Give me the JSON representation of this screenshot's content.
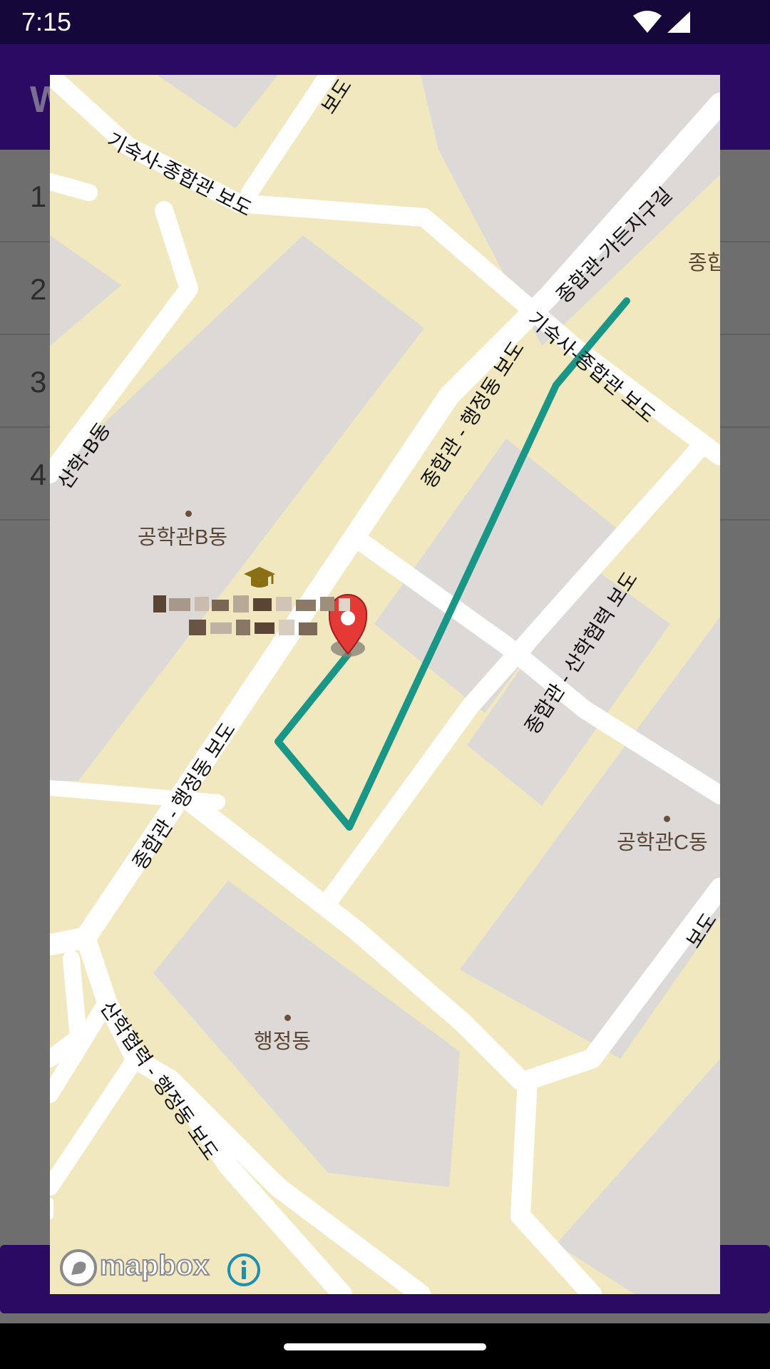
{
  "status_bar": {
    "time": "7:15"
  },
  "app": {
    "title": "W",
    "list": [
      "1",
      "2",
      "3",
      "4"
    ]
  },
  "map": {
    "attribution": "mapbox",
    "labels": {
      "engineering_b": "공학관B동",
      "engineering_c": "공학관C동",
      "admin": "행정동",
      "jonghap": "종합"
    },
    "road_labels": {
      "dorm_walk_top": "기숙사-종합관 보도",
      "dorm_walk_mid": "기숙사-종합관 보도",
      "jonghap_garden": "종합관-가든지구길",
      "jonghap_admin_upper": "종합관 - 행정동 보도",
      "jonghap_admin_lower": "종합관 - 행정동 보도",
      "jonghap_sanhak": "종합관 - 산학협력 보도",
      "sanhak_admin": "산학협력 - 행정동 보도",
      "sanhak_bdong": "산학-B동",
      "bodo_top": "보도",
      "bodo_right": "보도"
    },
    "colors": {
      "route": "#1a9686",
      "marker": "#e53935",
      "land": "#f1e8c0",
      "building": "#ddd9d7",
      "road": "#ffffff"
    }
  }
}
